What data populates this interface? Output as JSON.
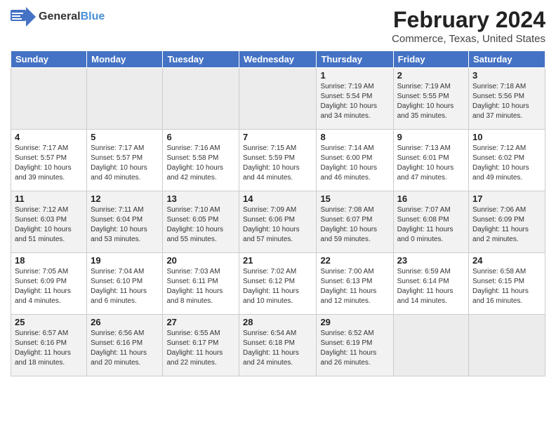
{
  "header": {
    "logo_general": "General",
    "logo_blue": "Blue",
    "month": "February 2024",
    "location": "Commerce, Texas, United States"
  },
  "weekdays": [
    "Sunday",
    "Monday",
    "Tuesday",
    "Wednesday",
    "Thursday",
    "Friday",
    "Saturday"
  ],
  "weeks": [
    [
      {
        "day": "",
        "info": ""
      },
      {
        "day": "",
        "info": ""
      },
      {
        "day": "",
        "info": ""
      },
      {
        "day": "",
        "info": ""
      },
      {
        "day": "1",
        "info": "Sunrise: 7:19 AM\nSunset: 5:54 PM\nDaylight: 10 hours\nand 34 minutes."
      },
      {
        "day": "2",
        "info": "Sunrise: 7:19 AM\nSunset: 5:55 PM\nDaylight: 10 hours\nand 35 minutes."
      },
      {
        "day": "3",
        "info": "Sunrise: 7:18 AM\nSunset: 5:56 PM\nDaylight: 10 hours\nand 37 minutes."
      }
    ],
    [
      {
        "day": "4",
        "info": "Sunrise: 7:17 AM\nSunset: 5:57 PM\nDaylight: 10 hours\nand 39 minutes."
      },
      {
        "day": "5",
        "info": "Sunrise: 7:17 AM\nSunset: 5:57 PM\nDaylight: 10 hours\nand 40 minutes."
      },
      {
        "day": "6",
        "info": "Sunrise: 7:16 AM\nSunset: 5:58 PM\nDaylight: 10 hours\nand 42 minutes."
      },
      {
        "day": "7",
        "info": "Sunrise: 7:15 AM\nSunset: 5:59 PM\nDaylight: 10 hours\nand 44 minutes."
      },
      {
        "day": "8",
        "info": "Sunrise: 7:14 AM\nSunset: 6:00 PM\nDaylight: 10 hours\nand 46 minutes."
      },
      {
        "day": "9",
        "info": "Sunrise: 7:13 AM\nSunset: 6:01 PM\nDaylight: 10 hours\nand 47 minutes."
      },
      {
        "day": "10",
        "info": "Sunrise: 7:12 AM\nSunset: 6:02 PM\nDaylight: 10 hours\nand 49 minutes."
      }
    ],
    [
      {
        "day": "11",
        "info": "Sunrise: 7:12 AM\nSunset: 6:03 PM\nDaylight: 10 hours\nand 51 minutes."
      },
      {
        "day": "12",
        "info": "Sunrise: 7:11 AM\nSunset: 6:04 PM\nDaylight: 10 hours\nand 53 minutes."
      },
      {
        "day": "13",
        "info": "Sunrise: 7:10 AM\nSunset: 6:05 PM\nDaylight: 10 hours\nand 55 minutes."
      },
      {
        "day": "14",
        "info": "Sunrise: 7:09 AM\nSunset: 6:06 PM\nDaylight: 10 hours\nand 57 minutes."
      },
      {
        "day": "15",
        "info": "Sunrise: 7:08 AM\nSunset: 6:07 PM\nDaylight: 10 hours\nand 59 minutes."
      },
      {
        "day": "16",
        "info": "Sunrise: 7:07 AM\nSunset: 6:08 PM\nDaylight: 11 hours\nand 0 minutes."
      },
      {
        "day": "17",
        "info": "Sunrise: 7:06 AM\nSunset: 6:09 PM\nDaylight: 11 hours\nand 2 minutes."
      }
    ],
    [
      {
        "day": "18",
        "info": "Sunrise: 7:05 AM\nSunset: 6:09 PM\nDaylight: 11 hours\nand 4 minutes."
      },
      {
        "day": "19",
        "info": "Sunrise: 7:04 AM\nSunset: 6:10 PM\nDaylight: 11 hours\nand 6 minutes."
      },
      {
        "day": "20",
        "info": "Sunrise: 7:03 AM\nSunset: 6:11 PM\nDaylight: 11 hours\nand 8 minutes."
      },
      {
        "day": "21",
        "info": "Sunrise: 7:02 AM\nSunset: 6:12 PM\nDaylight: 11 hours\nand 10 minutes."
      },
      {
        "day": "22",
        "info": "Sunrise: 7:00 AM\nSunset: 6:13 PM\nDaylight: 11 hours\nand 12 minutes."
      },
      {
        "day": "23",
        "info": "Sunrise: 6:59 AM\nSunset: 6:14 PM\nDaylight: 11 hours\nand 14 minutes."
      },
      {
        "day": "24",
        "info": "Sunrise: 6:58 AM\nSunset: 6:15 PM\nDaylight: 11 hours\nand 16 minutes."
      }
    ],
    [
      {
        "day": "25",
        "info": "Sunrise: 6:57 AM\nSunset: 6:16 PM\nDaylight: 11 hours\nand 18 minutes."
      },
      {
        "day": "26",
        "info": "Sunrise: 6:56 AM\nSunset: 6:16 PM\nDaylight: 11 hours\nand 20 minutes."
      },
      {
        "day": "27",
        "info": "Sunrise: 6:55 AM\nSunset: 6:17 PM\nDaylight: 11 hours\nand 22 minutes."
      },
      {
        "day": "28",
        "info": "Sunrise: 6:54 AM\nSunset: 6:18 PM\nDaylight: 11 hours\nand 24 minutes."
      },
      {
        "day": "29",
        "info": "Sunrise: 6:52 AM\nSunset: 6:19 PM\nDaylight: 11 hours\nand 26 minutes."
      },
      {
        "day": "",
        "info": ""
      },
      {
        "day": "",
        "info": ""
      }
    ]
  ]
}
